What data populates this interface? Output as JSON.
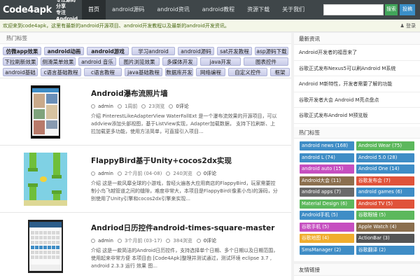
{
  "header": {
    "logo": "Code4apk",
    "logo_sub_1": "专注源码分享",
    "logo_sub_2": "专注Android",
    "nav": [
      "首页",
      "android源码",
      "android资讯",
      "android教程",
      "资源下载",
      "关于我们"
    ],
    "search_placeholder": "",
    "search_button": "搜索",
    "submit_button": "投稿"
  },
  "notice": {
    "text": "欢迎来到code4apk，这里有最新的android开源项目、android开发教程以及最新的android开发资讯。",
    "user": "登录"
  },
  "main": {
    "tags_title": "热门标签",
    "tag_rows": [
      [
        "仿微app效果",
        "android动画",
        "android游戏",
        "学习android",
        "android源码",
        "sat开发教程",
        "asp源码下载"
      ],
      [
        "下拉刷新效果",
        "侧滑菜单效果",
        "android 音乐",
        "图片浏览效果",
        "多媒体开发",
        "java开发",
        "图表控件"
      ],
      [
        "android基础",
        "c语言基础教程",
        "c语言教程",
        "java基础教程",
        "数据库开发",
        "网络编程",
        "自定义控件",
        "框架"
      ]
    ],
    "posts": [
      {
        "title": "Android瀑布流照片墙",
        "author": "admin",
        "date": "1周前",
        "views": "23浏览",
        "comments": "0评论",
        "excerpt": "介绍 PinterestLikeAdapterView WaterFallExt 是一个瀑布流效果的开源项目，可以addview添加头部视图，基于ListView实现，Adapter加载数据， 支持下拉刷新、上拉加载更多功能，使用方法简单，可直接引入项目..."
      },
      {
        "title": "FlappyBird基于Unity+cocos2dx实现",
        "author": "admin",
        "date": "2个月前 (04-08)",
        "views": "240浏览",
        "comments": "0评论",
        "excerpt": "介绍 这是一款风靡全球的小游戏，曾经火遍各大应用商店的FlappyBird，玩家需要控制小鸟飞越管道之间的缝隙，难度非常大，本项目是FlappyBird(像素小鸟)的源码，分别使用了Unity引擎和cocos2dx引擎来实现..."
      },
      {
        "title": "Andriod日历控件android-times-square-master",
        "author": "admin",
        "date": "3个月前 (03-17)",
        "views": "384浏览",
        "comments": "0评论",
        "excerpt": "介绍 这是一款简洁的Android日历控件，支持选择单个日期、多个日期以及日期范围，使用起来非常方便 本项目由 [Code4Apk]整理并测试通过，测试环境 eclipse 3.7 , android 2.3.3 运行 效果 图..."
      }
    ]
  },
  "sidebar": {
    "news_title": "最新资讯",
    "news": [
      "Android开发者的福音来了",
      "谷歌正式发布Nexus5可以刷Android M系统",
      "Android M新特性，开发者需要了解的功能",
      "谷歌开发者大会 Android M亮点盘点",
      "谷歌正式发布Android M预览版",
      "谷歌I/O大会发布 Android M新特性"
    ],
    "tags_title": "热门标签",
    "tags": [
      {
        "label": "android news (168)",
        "color": "#3f8dc6"
      },
      {
        "label": "Android Wear (75)",
        "color": "#5cb85c"
      },
      {
        "label": "android L (74)",
        "color": "#3f8dc6"
      },
      {
        "label": "Android 5.0 (28)",
        "color": "#3f8dc6"
      },
      {
        "label": "android auto (15)",
        "color": "#c64fc0"
      },
      {
        "label": "Android One (14)",
        "color": "#3f8dc6"
      },
      {
        "label": "Android大会 (11)",
        "color": "#8b6f4e"
      },
      {
        "label": "谷歌发布会 (7)",
        "color": "#e0533a"
      },
      {
        "label": "android apps (7)",
        "color": "#6a6a6a"
      },
      {
        "label": "android games (6)",
        "color": "#3f8dc6"
      },
      {
        "label": "Material Design (6)",
        "color": "#5cb85c"
      },
      {
        "label": "Android TV (5)",
        "color": "#e0533a"
      },
      {
        "label": "Android手机 (5)",
        "color": "#3f8dc6"
      },
      {
        "label": "谷歌眼镜 (5)",
        "color": "#5cb85c"
      },
      {
        "label": "谷歌手机 (5)",
        "color": "#c64fc0"
      },
      {
        "label": "Apple Watch (4)",
        "color": "#8b6f4e"
      },
      {
        "label": "谷歌地图 (4)",
        "color": "#f0ad2e"
      },
      {
        "label": "ActionBar (3)",
        "color": "#555555"
      },
      {
        "label": "SmsManager (2)",
        "color": "#3f8dc6"
      },
      {
        "label": "谷歌翻译 (2)",
        "color": "#3f8dc6"
      }
    ],
    "links_title": "友情链接"
  }
}
